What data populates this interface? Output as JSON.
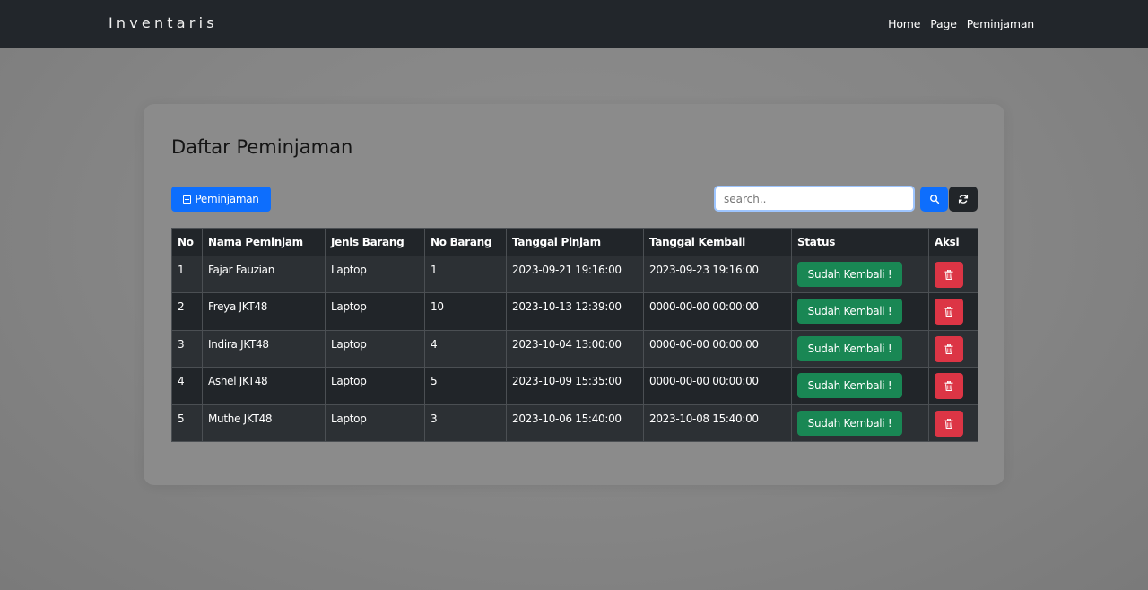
{
  "navbar": {
    "brand": "Inventaris",
    "links": [
      "Home",
      "Page",
      "Peminjaman"
    ]
  },
  "main": {
    "title": "Daftar Peminjaman",
    "add_button_label": "Peminjaman",
    "search": {
      "placeholder": "search..",
      "value": ""
    },
    "table": {
      "headers": [
        "No",
        "Nama Peminjam",
        "Jenis Barang",
        "No Barang",
        "Tanggal Pinjam",
        "Tanggal Kembali",
        "Status",
        "Aksi"
      ],
      "rows": [
        [
          "1",
          "Fajar Fauzian",
          "Laptop",
          "1",
          "2023-09-21 19:16:00",
          "2023-09-23 19:16:00",
          "Sudah Kembali !"
        ],
        [
          "2",
          "Freya JKT48",
          "Laptop",
          "10",
          "2023-10-13 12:39:00",
          "0000-00-00 00:00:00",
          "Sudah Kembali !"
        ],
        [
          "3",
          "Indira JKT48",
          "Laptop",
          "4",
          "2023-10-04 13:00:00",
          "0000-00-00 00:00:00",
          "Sudah Kembali !"
        ],
        [
          "4",
          "Ashel JKT48",
          "Laptop",
          "5",
          "2023-10-09 15:35:00",
          "0000-00-00 00:00:00",
          "Sudah Kembali !"
        ],
        [
          "5",
          "Muthe JKT48",
          "Laptop",
          "3",
          "2023-10-06 15:40:00",
          "2023-10-08 15:40:00",
          "Sudah Kembali !"
        ]
      ]
    }
  },
  "icons": {
    "add": "plus-square-icon",
    "search": "search-icon",
    "reset": "refresh-icon",
    "delete": "trash-icon"
  },
  "colors": {
    "primary": "#0d6efd",
    "success": "#198754",
    "danger": "#dc3545",
    "dark": "#212529"
  }
}
